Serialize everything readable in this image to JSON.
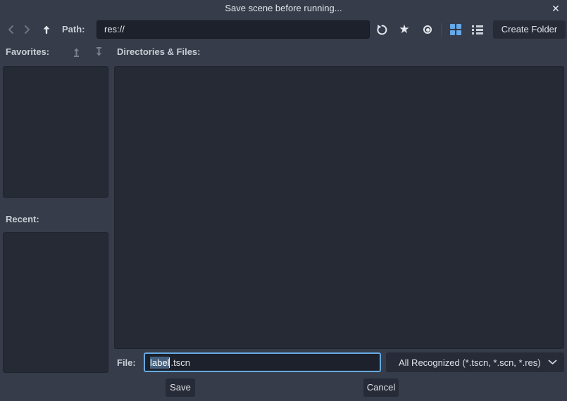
{
  "window": {
    "title": "Save scene before running...",
    "close_icon": "✕"
  },
  "toolbar": {
    "path_label": "Path:",
    "path_value": "res://",
    "refresh_icon": "refresh",
    "favorite_icon": "★",
    "toggle_hidden_icon": "circled-dot",
    "grid_view_icon": "thumbnail-grid",
    "list_view_icon": "list",
    "create_folder_label": "Create Folder"
  },
  "sidebar": {
    "favorites_label": "Favorites:",
    "recent_label": "Recent:"
  },
  "main": {
    "directories_label": "Directories & Files:"
  },
  "footer": {
    "file_label": "File:",
    "filename_selected": "label",
    "filename_rest": ".tscn",
    "filter_value": "All Recognized (*.tscn, *.scn, *.res)",
    "save_label": "Save",
    "cancel_label": "Cancel"
  },
  "colors": {
    "background": "#363c49",
    "panel": "#252a35",
    "input_background": "#1d212b",
    "button": "#262b37",
    "accent_blue": "#66a9e2",
    "selection": "#45617f",
    "text": "#e2e5eb"
  }
}
